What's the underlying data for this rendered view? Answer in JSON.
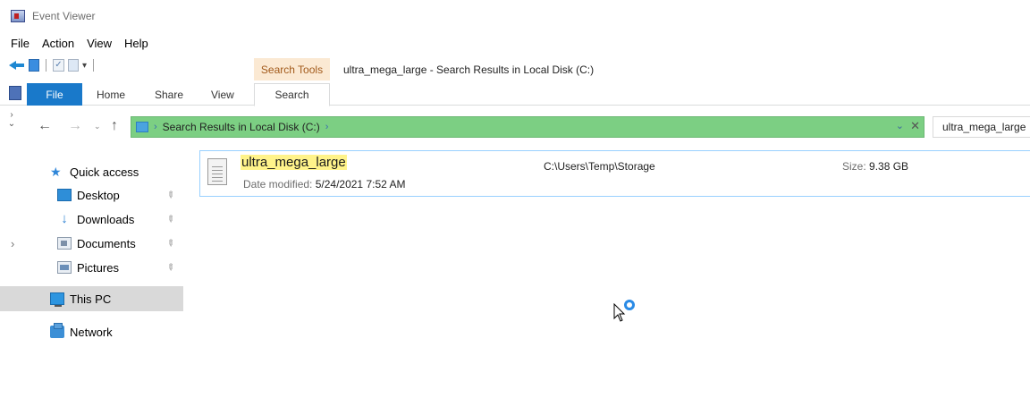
{
  "app": {
    "title": "Event Viewer",
    "menu": [
      "File",
      "Action",
      "View",
      "Help"
    ]
  },
  "explorer": {
    "contextual_tab_group": "Search Tools",
    "window_title": "ultra_mega_large - Search Results in Local Disk (C:)",
    "ribbon_tabs": {
      "file": "File",
      "home": "Home",
      "share": "Share",
      "view": "View",
      "search": "Search"
    },
    "address": {
      "path": "Search Results in Local Disk (C:)",
      "separator": "›",
      "bar_color": "#7ccf83"
    },
    "search_query": "ultra_mega_large",
    "nav_pane": {
      "quick_access": "Quick access",
      "items": [
        "Desktop",
        "Downloads",
        "Documents",
        "Pictures"
      ],
      "this_pc": "This PC",
      "network": "Network"
    },
    "result": {
      "name": "ultra_mega_large",
      "date_label": "Date modified:",
      "date_value": "5/24/2021 7:52 AM",
      "folder": "C:\\Users\\Temp\\Storage",
      "size_label": "Size:",
      "size_value": "9.38 GB"
    }
  }
}
